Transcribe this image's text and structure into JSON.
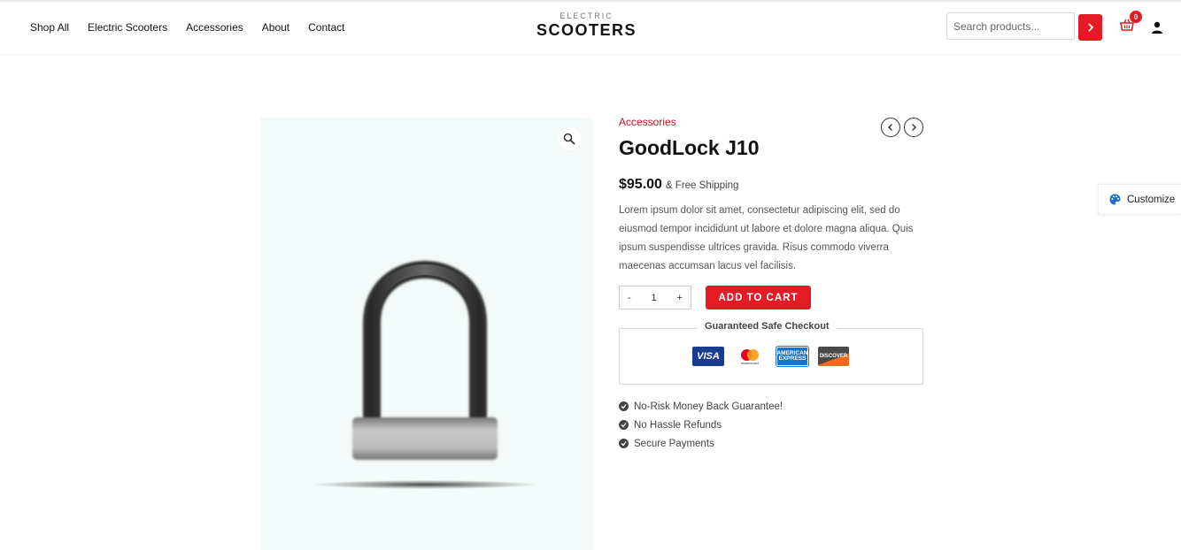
{
  "nav": {
    "items": [
      {
        "label": "Shop All"
      },
      {
        "label": "Electric Scooters"
      },
      {
        "label": "Accessories"
      },
      {
        "label": "About"
      },
      {
        "label": "Contact"
      }
    ]
  },
  "logo": {
    "small": "ELECTRIC",
    "big": "SCOOTERS"
  },
  "search": {
    "placeholder": "Search products..."
  },
  "cart": {
    "count": "0"
  },
  "product": {
    "category": "Accessories",
    "title": "GoodLock J10",
    "price": "$95.00",
    "shipping": "& Free Shipping",
    "description": "Lorem ipsum dolor sit amet, consectetur adipiscing elit, sed do eiusmod tempor incididunt ut labore et dolore magna aliqua. Quis ipsum suspendisse ultrices gravida. Risus commodo viverra maecenas accumsan lacus vel facilisis.",
    "quantity": "1",
    "qty_minus": "-",
    "qty_plus": "+",
    "add_to_cart": "ADD TO CART"
  },
  "checkout": {
    "title": "Guaranteed Safe Checkout",
    "cards": {
      "visa": "VISA",
      "mastercard": "mastercard",
      "amex_line1": "AMERICAN",
      "amex_line2": "EXPRESS",
      "discover": "DISCOVER"
    }
  },
  "guarantees": [
    {
      "label": "No-Risk Money Back Guarantee!"
    },
    {
      "label": "No Hassle Refunds"
    },
    {
      "label": "Secure Payments"
    }
  ],
  "customize": {
    "label": "Customize"
  },
  "colors": {
    "accent": "#e21b24",
    "gallery_bg": "#f3faf9"
  }
}
